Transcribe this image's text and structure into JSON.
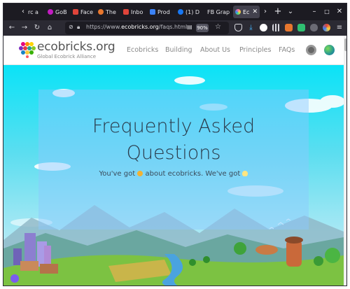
{
  "browser": {
    "tabs": [
      {
        "title": "rc a",
        "favicon_color": "#8a8a8a"
      },
      {
        "title": "GoB",
        "favicon_color": "#c21cc2"
      },
      {
        "title": "Face",
        "favicon_color": "#e0443a"
      },
      {
        "title": "The",
        "favicon_color": "#e8772e"
      },
      {
        "title": "Inbo",
        "favicon_color": "#e0443a"
      },
      {
        "title": "Prod",
        "favicon_color": "#3b82f6"
      },
      {
        "title": "(1) D",
        "favicon_color": "#1877f2"
      },
      {
        "title": "FB Grap",
        "favicon_color": "#888888"
      },
      {
        "title": "Ec",
        "favicon_color": "#ff6aa2"
      }
    ],
    "url_prefix": "https://www.",
    "url_domain": "ecobricks.org",
    "url_path": "/faqs.html",
    "zoom": "90%"
  },
  "site": {
    "brand": "ecobricks.org",
    "tagline": "Global Ecobrick Alliance",
    "nav": [
      "Ecobricks",
      "Building",
      "About Us",
      "Principles",
      "FAQs"
    ]
  },
  "hero": {
    "title_line1": "Frequently Asked",
    "title_line2": "Questions",
    "sub_part1": "You've got",
    "sub_part2": "about ecobricks. We've got"
  },
  "colors": {
    "sky": "#0ae3f7",
    "brand_text": "#555555",
    "nav_text": "#888888"
  }
}
